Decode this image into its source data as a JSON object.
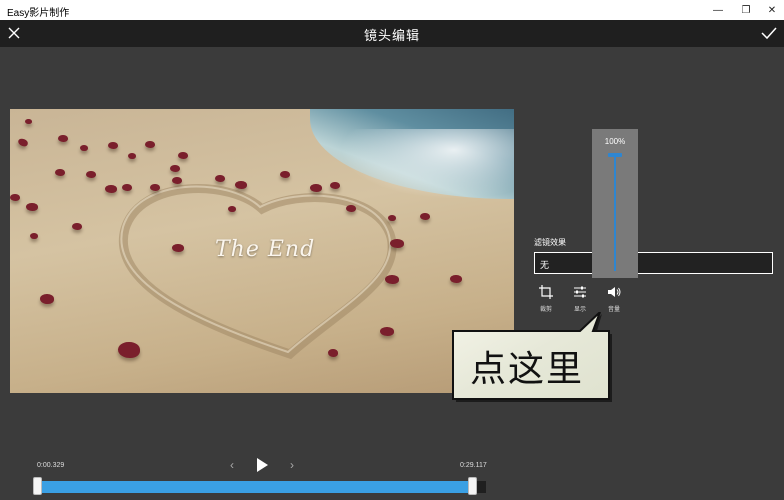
{
  "window": {
    "app_title": "Easy影片制作",
    "minimize_glyph": "—",
    "maximize_glyph": "❐",
    "close_glyph": "✕"
  },
  "header": {
    "title": "镜头编辑",
    "close_icon": "close-icon",
    "confirm_icon": "check-icon"
  },
  "video": {
    "overlay_text": "The End"
  },
  "filter": {
    "label": "滤镜效果",
    "value": "无"
  },
  "tools": [
    {
      "label": "裁剪",
      "icon": "crop-icon"
    },
    {
      "label": "显示",
      "icon": "adjust-icon"
    },
    {
      "label": "音量",
      "icon": "volume-icon"
    }
  ],
  "volume": {
    "value_text": "100%",
    "level": 1.0
  },
  "callout": {
    "text": "点这里"
  },
  "playback": {
    "start_time": "0:00.329",
    "end_time": "0:29.117",
    "prev_glyph": "‹",
    "next_glyph": "›"
  },
  "colors": {
    "accent": "#3aa0e4",
    "background": "#3b3b3b",
    "header": "#1f1f1f"
  }
}
